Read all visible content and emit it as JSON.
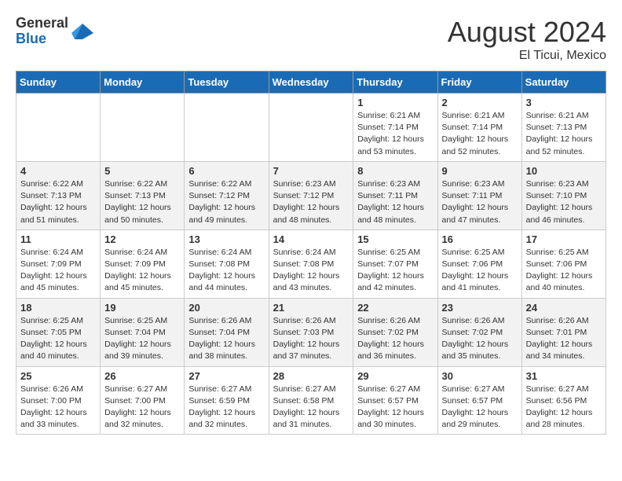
{
  "logo": {
    "general": "General",
    "blue": "Blue"
  },
  "header": {
    "month": "August 2024",
    "location": "El Ticui, Mexico"
  },
  "weekdays": [
    "Sunday",
    "Monday",
    "Tuesday",
    "Wednesday",
    "Thursday",
    "Friday",
    "Saturday"
  ],
  "weeks": [
    [
      {
        "day": "",
        "info": ""
      },
      {
        "day": "",
        "info": ""
      },
      {
        "day": "",
        "info": ""
      },
      {
        "day": "",
        "info": ""
      },
      {
        "day": "1",
        "info": "Sunrise: 6:21 AM\nSunset: 7:14 PM\nDaylight: 12 hours\nand 53 minutes."
      },
      {
        "day": "2",
        "info": "Sunrise: 6:21 AM\nSunset: 7:14 PM\nDaylight: 12 hours\nand 52 minutes."
      },
      {
        "day": "3",
        "info": "Sunrise: 6:21 AM\nSunset: 7:13 PM\nDaylight: 12 hours\nand 52 minutes."
      }
    ],
    [
      {
        "day": "4",
        "info": "Sunrise: 6:22 AM\nSunset: 7:13 PM\nDaylight: 12 hours\nand 51 minutes."
      },
      {
        "day": "5",
        "info": "Sunrise: 6:22 AM\nSunset: 7:13 PM\nDaylight: 12 hours\nand 50 minutes."
      },
      {
        "day": "6",
        "info": "Sunrise: 6:22 AM\nSunset: 7:12 PM\nDaylight: 12 hours\nand 49 minutes."
      },
      {
        "day": "7",
        "info": "Sunrise: 6:23 AM\nSunset: 7:12 PM\nDaylight: 12 hours\nand 48 minutes."
      },
      {
        "day": "8",
        "info": "Sunrise: 6:23 AM\nSunset: 7:11 PM\nDaylight: 12 hours\nand 48 minutes."
      },
      {
        "day": "9",
        "info": "Sunrise: 6:23 AM\nSunset: 7:11 PM\nDaylight: 12 hours\nand 47 minutes."
      },
      {
        "day": "10",
        "info": "Sunrise: 6:23 AM\nSunset: 7:10 PM\nDaylight: 12 hours\nand 46 minutes."
      }
    ],
    [
      {
        "day": "11",
        "info": "Sunrise: 6:24 AM\nSunset: 7:09 PM\nDaylight: 12 hours\nand 45 minutes."
      },
      {
        "day": "12",
        "info": "Sunrise: 6:24 AM\nSunset: 7:09 PM\nDaylight: 12 hours\nand 45 minutes."
      },
      {
        "day": "13",
        "info": "Sunrise: 6:24 AM\nSunset: 7:08 PM\nDaylight: 12 hours\nand 44 minutes."
      },
      {
        "day": "14",
        "info": "Sunrise: 6:24 AM\nSunset: 7:08 PM\nDaylight: 12 hours\nand 43 minutes."
      },
      {
        "day": "15",
        "info": "Sunrise: 6:25 AM\nSunset: 7:07 PM\nDaylight: 12 hours\nand 42 minutes."
      },
      {
        "day": "16",
        "info": "Sunrise: 6:25 AM\nSunset: 7:06 PM\nDaylight: 12 hours\nand 41 minutes."
      },
      {
        "day": "17",
        "info": "Sunrise: 6:25 AM\nSunset: 7:06 PM\nDaylight: 12 hours\nand 40 minutes."
      }
    ],
    [
      {
        "day": "18",
        "info": "Sunrise: 6:25 AM\nSunset: 7:05 PM\nDaylight: 12 hours\nand 40 minutes."
      },
      {
        "day": "19",
        "info": "Sunrise: 6:25 AM\nSunset: 7:04 PM\nDaylight: 12 hours\nand 39 minutes."
      },
      {
        "day": "20",
        "info": "Sunrise: 6:26 AM\nSunset: 7:04 PM\nDaylight: 12 hours\nand 38 minutes."
      },
      {
        "day": "21",
        "info": "Sunrise: 6:26 AM\nSunset: 7:03 PM\nDaylight: 12 hours\nand 37 minutes."
      },
      {
        "day": "22",
        "info": "Sunrise: 6:26 AM\nSunset: 7:02 PM\nDaylight: 12 hours\nand 36 minutes."
      },
      {
        "day": "23",
        "info": "Sunrise: 6:26 AM\nSunset: 7:02 PM\nDaylight: 12 hours\nand 35 minutes."
      },
      {
        "day": "24",
        "info": "Sunrise: 6:26 AM\nSunset: 7:01 PM\nDaylight: 12 hours\nand 34 minutes."
      }
    ],
    [
      {
        "day": "25",
        "info": "Sunrise: 6:26 AM\nSunset: 7:00 PM\nDaylight: 12 hours\nand 33 minutes."
      },
      {
        "day": "26",
        "info": "Sunrise: 6:27 AM\nSunset: 7:00 PM\nDaylight: 12 hours\nand 32 minutes."
      },
      {
        "day": "27",
        "info": "Sunrise: 6:27 AM\nSunset: 6:59 PM\nDaylight: 12 hours\nand 32 minutes."
      },
      {
        "day": "28",
        "info": "Sunrise: 6:27 AM\nSunset: 6:58 PM\nDaylight: 12 hours\nand 31 minutes."
      },
      {
        "day": "29",
        "info": "Sunrise: 6:27 AM\nSunset: 6:57 PM\nDaylight: 12 hours\nand 30 minutes."
      },
      {
        "day": "30",
        "info": "Sunrise: 6:27 AM\nSunset: 6:57 PM\nDaylight: 12 hours\nand 29 minutes."
      },
      {
        "day": "31",
        "info": "Sunrise: 6:27 AM\nSunset: 6:56 PM\nDaylight: 12 hours\nand 28 minutes."
      }
    ]
  ]
}
